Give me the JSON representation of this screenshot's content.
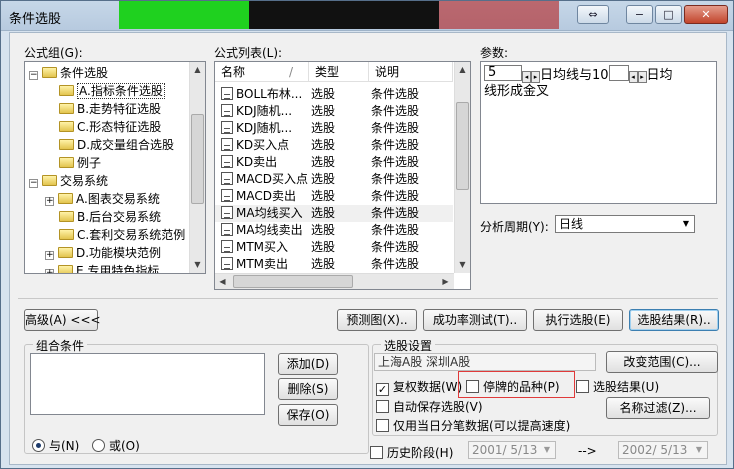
{
  "window": {
    "title": "条件选股",
    "colors": {
      "accent": "#3c7fb1",
      "highlight_border": "#e03a3a",
      "titlebar": "#c6d7e8"
    }
  },
  "formula_group": {
    "label": "公式组(G):",
    "items": [
      {
        "text": "条件选股",
        "expander": "−",
        "level": 0
      },
      {
        "text": "A.指标条件选股",
        "level": 1,
        "selected": true
      },
      {
        "text": "B.走势特征选股",
        "level": 1
      },
      {
        "text": "C.形态特征选股",
        "level": 1
      },
      {
        "text": "D.成交量组合选股",
        "level": 1
      },
      {
        "text": "例子",
        "level": 1
      },
      {
        "text": "交易系统",
        "expander": "−",
        "level": 0
      },
      {
        "text": "A.图表交易系统",
        "expander": "+",
        "level": 1
      },
      {
        "text": "B.后台交易系统",
        "level": 1
      },
      {
        "text": "C.套利交易系统范例",
        "level": 1
      },
      {
        "text": "D.功能模块范例",
        "expander": "+",
        "level": 1
      },
      {
        "text": "E.专用特色指标",
        "expander": "+",
        "level": 1
      }
    ]
  },
  "formula_list": {
    "label": "公式列表(L):",
    "headers": {
      "name": "名称",
      "sep": "/",
      "type": "类型",
      "desc": "说明"
    },
    "rows": [
      {
        "name": "BOLL布林...",
        "type": "选股",
        "desc": "条件选股"
      },
      {
        "name": "KDJ随机...",
        "type": "选股",
        "desc": "条件选股"
      },
      {
        "name": "KDJ随机...",
        "type": "选股",
        "desc": "条件选股"
      },
      {
        "name": "KD买入点",
        "type": "选股",
        "desc": "条件选股"
      },
      {
        "name": "KD卖出",
        "type": "选股",
        "desc": "条件选股"
      },
      {
        "name": "MACD买入点",
        "type": "选股",
        "desc": "条件选股"
      },
      {
        "name": "MACD卖出",
        "type": "选股",
        "desc": "条件选股"
      },
      {
        "name": "MA均线买入",
        "type": "选股",
        "desc": "条件选股"
      },
      {
        "name": "MA均线卖出",
        "type": "选股",
        "desc": "条件选股"
      },
      {
        "name": "MTM买入",
        "type": "选股",
        "desc": "条件选股"
      },
      {
        "name": "MTM卖出",
        "type": "选股",
        "desc": "条件选股"
      }
    ]
  },
  "params": {
    "label": "参数:",
    "value1": "5",
    "text1": "日均线与10",
    "value2": "",
    "text2": "日均",
    "text3": "线形成金叉"
  },
  "period": {
    "label": "分析周期(Y):",
    "value": "日线"
  },
  "buttons": {
    "advanced": "高级(A) <<<",
    "preview": "预测图(X)..",
    "success_test": "成功率测试(T)..",
    "run": "执行选股(E)",
    "result": "选股结果(R)..",
    "add": "添加(D)",
    "delete": "删除(S)",
    "save": "保存(O)",
    "change_range": "改变范围(C)...",
    "name_filter": "名称过滤(Z)..."
  },
  "combo": {
    "title": "组合条件",
    "and": "与(N)",
    "or": "或(O)"
  },
  "settings": {
    "title": "选股设置",
    "range_text": "上海A股  深圳A股",
    "restore": "复权数据(W)",
    "suspended": "停牌的品种(P)",
    "to_result": "选股结果(U)",
    "auto_save": "自动保存选股(V)",
    "tick_only": "仅用当日分笔数据(可以提高速度)",
    "history": "历史阶段(H)",
    "date_from": "2001/ 5/13",
    "arrow": "-->",
    "date_to": "2002/ 5/13"
  }
}
